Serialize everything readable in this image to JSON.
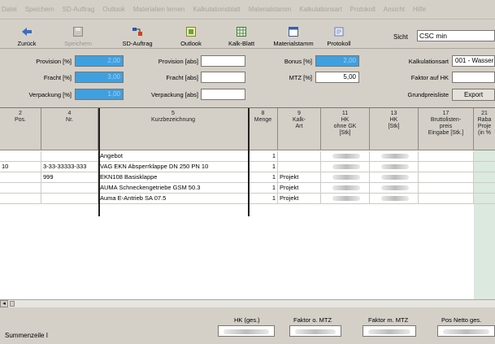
{
  "menu": [
    "Datei",
    "Speichern",
    "SD-Auftrag",
    "Outlook",
    "Materialien lernen",
    "Kalkulationsblatt",
    "Materialstamm",
    "Kalkulationsart",
    "Protokoll",
    "Ansicht",
    "Hilfe"
  ],
  "toolbar": {
    "back": "Zurück",
    "save": "Speichern",
    "sd_order": "SD-Auftrag",
    "outlook": "Outlook",
    "calc_sheet": "Kalk-Blatt",
    "material_master": "Materialstamm",
    "protocol": "Protokoll",
    "view_label": "Sicht",
    "view_value": "CSC min"
  },
  "fields": {
    "provision_pct_label": "Provision [%]",
    "provision_pct_value": "2,00",
    "fracht_pct_label": "Fracht [%]",
    "fracht_pct_value": "3,00",
    "verpackung_pct_label": "Verpackung [%]",
    "verpackung_pct_value": "1,00",
    "provision_abs_label": "Provision [abs]",
    "fracht_abs_label": "Fracht [abs]",
    "verpackung_abs_label": "Verpackung [abs]",
    "bonus_label": "Bonus [%]",
    "bonus_value": "2,00",
    "mtz_label": "MTZ [%]",
    "mtz_value": "5,00",
    "kalkulationsart_label": "Kalkulationsart",
    "kalkulationsart_value": "001 - Wasser",
    "faktor_hk_label": "Faktor auf HK",
    "grundpreisliste_label": "Grundpreisliste",
    "export_label": "Export"
  },
  "grid": {
    "headers": [
      "2\nPos.",
      "4\nNr.",
      "5\nKurzbezeichnung",
      "8\nMenge",
      "9\nKalk-\nArt",
      "11\nHK\nohne GK\n[Stk]",
      "13\nHK\n[Stk]",
      "17\nBruttolisten-\npreis\nEingabe [Stk.]",
      "21\nRaba\nProje\n(in %"
    ],
    "rows": [
      {
        "pos": "",
        "nr": "",
        "desc": "Angebot",
        "menge": "1",
        "art": "",
        "hk_ogk": true,
        "hk": true
      },
      {
        "pos": "10",
        "nr": "3-33-33333-333",
        "desc": "VAG EKN Absperrklappe DN 250 PN 10",
        "menge": "1",
        "art": "",
        "hk_ogk": true,
        "hk": true
      },
      {
        "pos": "",
        "nr": "999",
        "desc": "EKN108 Basisklappe",
        "menge": "1",
        "art": "Projekt",
        "hk_ogk": true,
        "hk": true
      },
      {
        "pos": "",
        "nr": "",
        "desc": "AUMA Schneckengetriebe GSM 50.3",
        "menge": "1",
        "art": "Projekt",
        "hk_ogk": true,
        "hk": true
      },
      {
        "pos": "",
        "nr": "",
        "desc": "Auma E-Antrieb SA 07.5",
        "menge": "1",
        "art": "Projekt",
        "hk_ogk": true,
        "hk": true
      }
    ]
  },
  "footer": {
    "summary_label": "Summenzeile I",
    "hk_total_label": "HK (ges.)",
    "faktor_o_mtz_label": "Faktor o. MTZ",
    "faktor_m_mtz_label": "Faktor m. MTZ",
    "pos_netto_label": "Pos Netto ges."
  },
  "colors": {
    "accent_blue": "#3fa0e0",
    "window_bg": "#d4d0c8",
    "green_column": "#dbe9df"
  }
}
